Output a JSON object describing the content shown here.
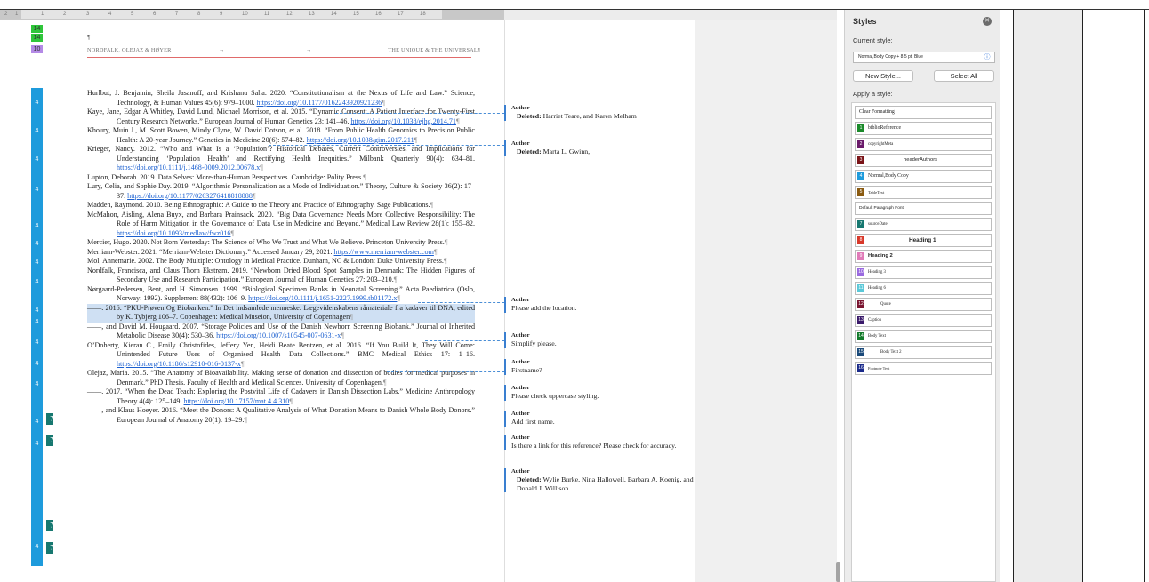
{
  "ruler": {
    "ticks": [
      "2",
      "1",
      "1",
      "2",
      "3",
      "4",
      "5",
      "6",
      "7",
      "8",
      "9",
      "10",
      "11",
      "12",
      "13",
      "14",
      "15",
      "16",
      "17",
      "18"
    ]
  },
  "style_chips": [
    "14",
    "14",
    "10"
  ],
  "blue_strip_numbers": [
    "4",
    "4",
    "4",
    "4",
    "4",
    "4",
    "4",
    "4",
    "4",
    "4",
    "4",
    "4",
    "4",
    "4",
    "4",
    "4"
  ],
  "teal_badges": [
    "7",
    "7",
    "7",
    "7"
  ],
  "page": {
    "top_text": "¶",
    "header_left": "NORDFALK, OLEJAZ & HØYER",
    "header_mid1": "→",
    "header_mid2": "→",
    "header_right": "THE UNIQUE & THE UNIVERSAL¶"
  },
  "references": [
    "Hurlbut, J. Benjamin, Sheila Jasanoff, and Krishanu Saha. 2020. “Constitutionalism at the Nexus of Life and Law.” Science, Technology, & Human Values 45(6): 979–1000.",
    "Kaye, Jane, Edgar A Whitley, David Lund, Michael Morrison, et al. 2015. “Dynamic Consent: A Patient Interface for Twenty-First Century Research Networks.” European Journal of Human Genetics 23: 141–46.",
    "Khoury, Muin J., M. Scott Bowen, Mindy Clyne, W. David Dotson, et al. 2018. “From Public Health Genomics to Precision Public Health: A 20-year Journey.” Genetics in Medicine 20(6): 574–82.",
    "Krieger, Nancy. 2012. “Who and What Is a ‘Population’? Historical Debates, Current Controversies, and Implications for Understanding ‘Population Health’ and Rectifying Health Inequities.” Milbank Quarterly 90(4): 634–81.",
    "Lupton, Deborah. 2019. Data Selves: More-than-Human Perspectives. Cambridge: Polity Press.",
    "Lury, Celia, and Sophie Day. 2019. “Algorithmic Personalization as a Mode of Individuation.” Theory, Culture & Society 36(2): 17–37.",
    "Madden, Raymond. 2010. Being Ethnographic: A Guide to the Theory and Practice of Ethnography. Sage Publications.",
    "McMahon, Aisling, Alena Buyx, and Barbara Prainsack. 2020. “Big Data Governance Needs More Collective Responsibility: The Role of Harm Mitigation in the Governance of Data Use in Medicine and Beyond.” Medical Law Review 28(1): 155–82.",
    "Mercier, Hugo. 2020. Not Born Yesterday: The Science of Who We Trust and What We Believe. Princeton University Press.",
    "Merriam-Webster. 2021. “Merriam-Webster Dictionary.” Accessed January 29, 2021.",
    "Mol, Annemarie. 2002. The Body Multiple: Ontology in Medical Practice. Dunham, NC & London: Duke University Press.",
    "Nordfalk, Francisca, and Claus Thorn Ekstrøm. 2019. “Newborn Dried Blood Spot Samples in Denmark: The Hidden Figures of Secondary Use and Research Participation.” European Journal of Human Genetics 27: 203–210.",
    "Nørgaard-Pedersen, Bent, and H. Simonsen. 1999. “Biological Specimen Banks in Neonatal Screening.” Acta Paediatrica (Oslo, Norway: 1992). Supplement 88(432): 106–9.",
    "——. 2016. “PKU-Prøven Og Biobanken.” In Det indsamlede menneske: Lægevidenskabens råmateriale fra kadaver til DNA, edited by K. Tybjerg 106–7. Copenhagen: Medical Museion, University of Copenhagen",
    "——, and David M. Hougaard. 2007. “Storage Policies and Use of the Danish Newborn Screening Biobank.” Journal of Inherited Metabolic Disease 30(4): 530–36.",
    "O’Doherty, Kieran C., Emily Christofides, Jeffery Yen, Heidi Beate Bentzen, et al. 2016. “If You Build It, They Will Come: Unintended Future Uses of Organised Health Data Collections.” BMC Medical Ethics 17: 1–16.",
    "Olejaz, Maria. 2015. “The Anatomy of Bioavailability. Making sense of donation and dissection of bodies for medical purposes in Denmark.” PhD Thesis. Faculty of Health and Medical Sciences. University of Copenhagen.",
    "——. 2017. “When the Dead Teach: Exploring the Postvital Life of Cadavers in Danish Dissection Labs.” Medicine Anthropology Theory 4(4): 125–149.",
    "——, and Klaus Hoeyer. 2016. “Meet the Donors: A Qualitative Analysis of What Donation Means to Danish Whole Body Donors.” European Journal of Anatomy 20(1): 19–29."
  ],
  "links": {
    "hurlbut": "https://doi.org/10.1177/0162243920921236",
    "kaye": "https://doi.org/10.1038/ejhg.2014.71",
    "khoury": "https://doi.org/10.1038/gim.2017.211",
    "krieger": "https://doi.org/10.1111/j.1468-0009.2012.00678.x",
    "lury": "https://doi.org/10.1177/0263276418818888",
    "mcmahon": "https://doi.org/10.1093/medlaw/fwz016",
    "mw1": "https://www.merriam-",
    "mw2": "webster.com",
    "norg": "https://doi.org/10.1111/j.1651-2227.1999.tb01172.x",
    "hougaard": "https://doi.org/10.1007/s10545-007-0631-x",
    "odoherty": "https://doi.org/10.1186/s12910-016-0137-x",
    "olejaz2017": "https://doi.org/10.17157/mat.4.4.310"
  },
  "comments": [
    {
      "author": "Author",
      "deleted_label": "Deleted:",
      "text": "Harriet Teare, and Karen Melham"
    },
    {
      "author": "Author",
      "deleted_label": "Deleted:",
      "text": "Marta L. Gwinn,"
    },
    {
      "author": "Author",
      "text": "Please add the location."
    },
    {
      "author": "Author",
      "text": "Simplify please."
    },
    {
      "author": "Author",
      "text": "Firstname?"
    },
    {
      "author": "Author",
      "text": "Please check uppercase styling."
    },
    {
      "author": "Author",
      "text": "Add first name."
    },
    {
      "author": "Author",
      "text": "Is there a link for this reference? Please check for accuracy."
    },
    {
      "author": "Author",
      "deleted_label": "Deleted:",
      "text": "Wylie Burke, Nina Hallowell, Barbara A. Koenig, and Donald J. Willison"
    }
  ],
  "styles_panel": {
    "title": "Styles",
    "current_style_label": "Current style:",
    "current_style_value": "Normal,Body Copy + 8.5 pt, Blue",
    "new_style_button": "New Style...",
    "select_all_button": "Select All",
    "apply_label": "Apply a style:",
    "items": [
      {
        "num": "",
        "label": "Clear Formatting",
        "color": ""
      },
      {
        "num": "1",
        "label": "biblioReference",
        "color": "#1a8a2a"
      },
      {
        "num": "2",
        "label": "copyrightMeta",
        "color": "#6a1a6a"
      },
      {
        "num": "3",
        "label": "headerAuthors",
        "color": "#7a1418"
      },
      {
        "num": "4",
        "label": "Normal,Body Copy",
        "color": "#1e9bdc"
      },
      {
        "num": "5",
        "label": "TableText",
        "color": "#8a5a10"
      },
      {
        "num": "",
        "label": "Default Paragraph Font",
        "color": ""
      },
      {
        "num": "7",
        "label": "sourceDate",
        "color": "#177870"
      },
      {
        "num": "8",
        "label": "Heading 1",
        "color": "#d8382a"
      },
      {
        "num": "9",
        "label": "Heading 2",
        "color": "#e07ab8"
      },
      {
        "num": "10",
        "label": "Heading 3",
        "color": "#9a6ae0"
      },
      {
        "num": "11",
        "label": "Heading 6",
        "color": "#5ac8d8"
      },
      {
        "num": "12",
        "label": "Quote",
        "color": "#7a1430"
      },
      {
        "num": "13",
        "label": "Caption",
        "color": "#3a1a6a"
      },
      {
        "num": "14",
        "label": "Body Text",
        "color": "#127a2a"
      },
      {
        "num": "15",
        "label": "Body Text 2",
        "color": "#1a4a7a"
      },
      {
        "num": "16",
        "label": "Footnote Text",
        "color": "#1a2a8a"
      }
    ]
  }
}
